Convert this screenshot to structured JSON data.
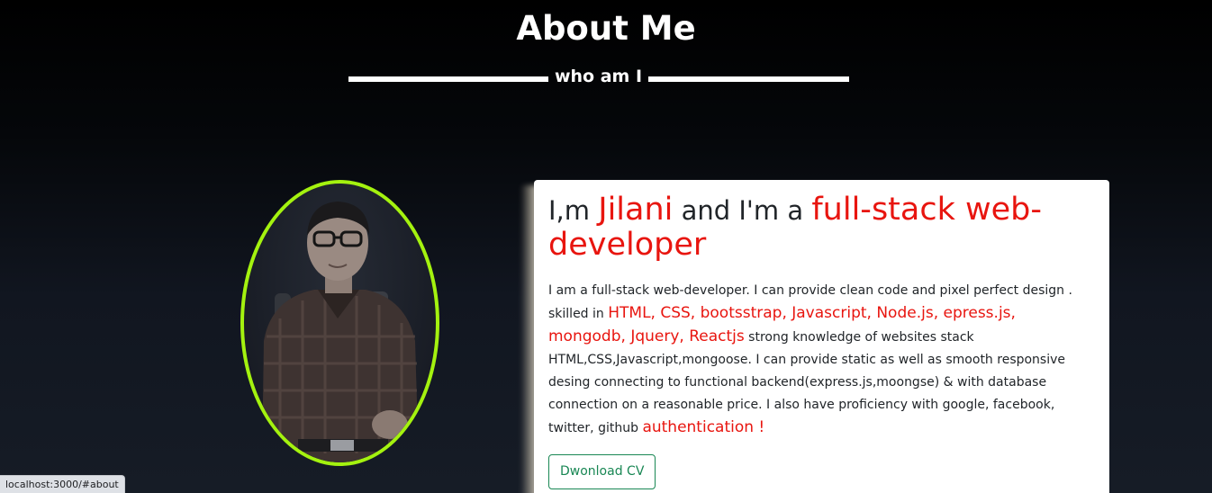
{
  "section": {
    "title": "About Me",
    "subtitle": "who am I"
  },
  "profile": {
    "photo_icon": "person-portrait",
    "ring_color": "#a4f20f"
  },
  "card": {
    "headline_prefix": "I,m ",
    "name": "Jilani",
    "headline_middle": " and I'm a ",
    "role": "full-stack web-developer",
    "bio_part1": "I am a full-stack web-developer. I can provide clean code and pixel perfect design . skilled in ",
    "skills": "HTML, CSS, bootsstrap, Javascript, Node.js, epress.js, mongodb, Jquery, Reactjs",
    "bio_part2": " strong knowledge of websites stack HTML,CSS,Javascript,mongoose. I can provide static as well as smooth responsive desing connecting to functional backend(express.js,moongse) & with database connection on a reasonable price. I also have proficiency with google, facebook, twitter, github ",
    "auth": "authentication !",
    "download_label": "Dwonload CV",
    "accent_color": "#e8150f",
    "button_color": "#198754"
  },
  "status_bar": {
    "url": "localhost:3000/#about"
  }
}
